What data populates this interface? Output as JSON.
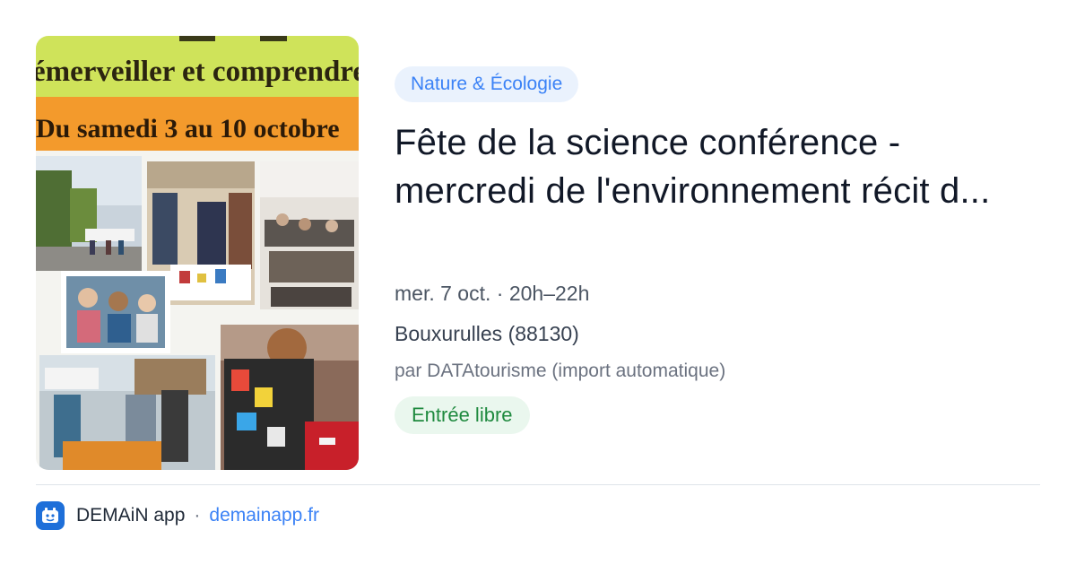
{
  "poster": {
    "line1": "émerveiller et comprendre",
    "line2": "Du samedi 3 au 10 octobre"
  },
  "event": {
    "category": "Nature & Écologie",
    "title": "Fête de la science conférence - mercredi de l'environnement récit d...",
    "when": "mer. 7 oct. · 20h–22h",
    "location": "Bouxurulles (88130)",
    "organizer": "par DATAtourisme (import automatique)",
    "price": "Entrée libre"
  },
  "footer": {
    "app_name": "DEMAiN app",
    "separator": "·",
    "domain": "demainapp.fr",
    "icon": "demain-app-icon"
  },
  "colors": {
    "accent": "#3b82f6",
    "chip_blue_bg": "#eaf2fd",
    "chip_green_bg": "#eaf7ee",
    "chip_green_text": "#1f8a3f",
    "poster_green": "#cfe35a",
    "poster_orange": "#f39a2c"
  }
}
